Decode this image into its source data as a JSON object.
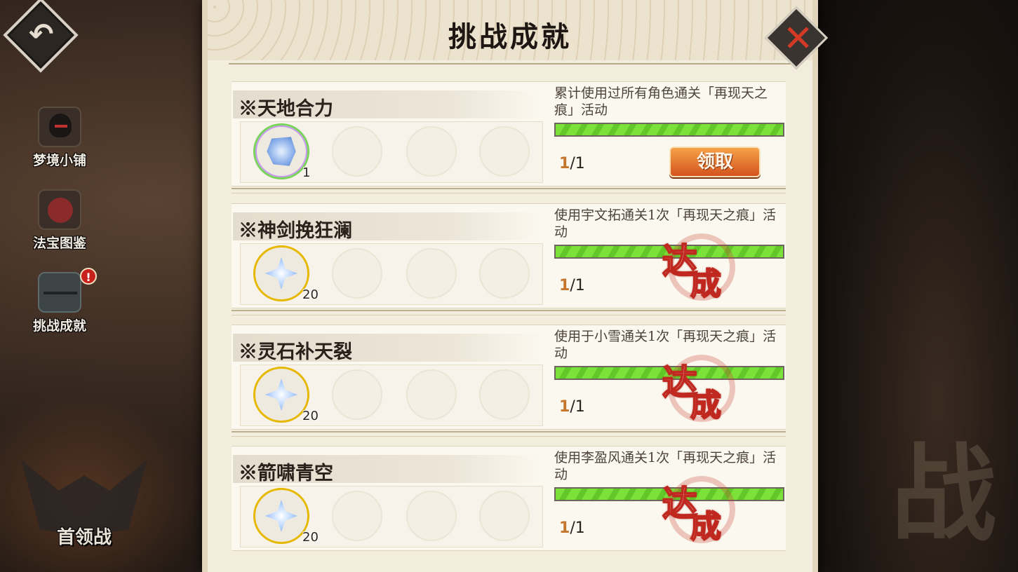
{
  "panel": {
    "title": "挑战成就"
  },
  "side_menu": [
    {
      "label": "梦境小铺",
      "icon": "cat-merchant-icon"
    },
    {
      "label": "法宝图鉴",
      "icon": "treasure-book-icon"
    },
    {
      "label": "挑战成就",
      "icon": "chest-icon",
      "badge": "!"
    }
  ],
  "boss_button": {
    "label": "首领战",
    "icon": "bat-wings-icon"
  },
  "tasks": [
    {
      "name": "※天地合力",
      "description": "累计使用过所有角色通关「再现天之痕」活动",
      "progress_current": "1",
      "progress_sep": "/1",
      "progress_fraction": 1.0,
      "reward_count": "1",
      "reward_icon": "blue-crystal-icon",
      "action_label": "领取",
      "completed": false
    },
    {
      "name": "※神剑挽狂澜",
      "description": "使用宇文拓通关1次「再现天之痕」活动",
      "progress_current": "1",
      "progress_sep": "/1",
      "progress_fraction": 1.0,
      "reward_count": "20",
      "reward_icon": "star-crystal-icon",
      "stamp": [
        "达",
        "成"
      ],
      "completed": true
    },
    {
      "name": "※灵石补天裂",
      "description": "使用于小雪通关1次「再现天之痕」活动",
      "progress_current": "1",
      "progress_sep": "/1",
      "progress_fraction": 1.0,
      "reward_count": "20",
      "reward_icon": "star-crystal-icon",
      "stamp": [
        "达",
        "成"
      ],
      "completed": true
    },
    {
      "name": "※箭啸青空",
      "description": "使用李盈风通关1次「再现天之痕」活动",
      "progress_current": "1",
      "progress_sep": "/1",
      "progress_fraction": 1.0,
      "reward_count": "20",
      "reward_icon": "star-crystal-icon",
      "stamp": [
        "达",
        "成"
      ],
      "completed": true
    }
  ],
  "colors": {
    "progress_green": "#7be23a",
    "claim_orange": "#e8782e",
    "stamp_red": "#c0281f"
  }
}
